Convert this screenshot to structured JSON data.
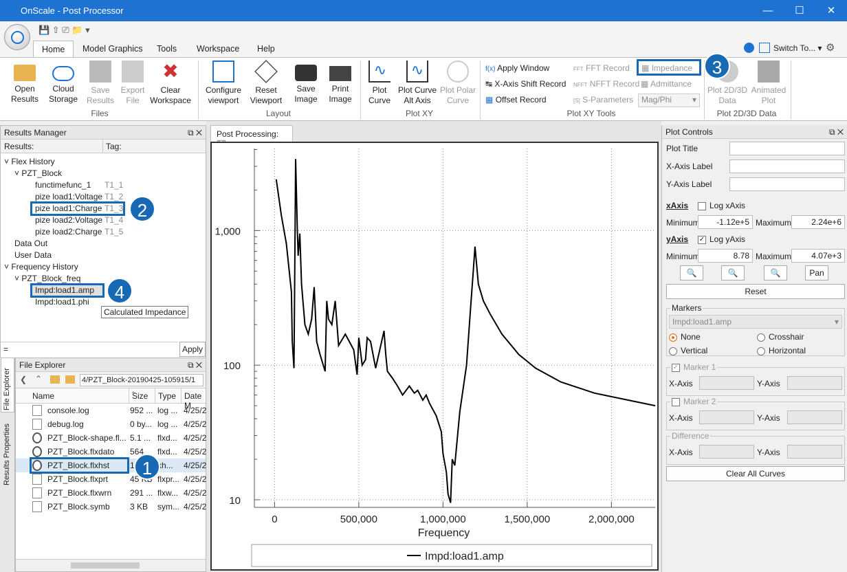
{
  "window": {
    "title": "OnScale - Post Processor",
    "min_icon": "minimize-icon",
    "max_icon": "maximize-icon",
    "close_icon": "close-icon"
  },
  "tabs": [
    {
      "label": "Home"
    },
    {
      "label": "Model Graphics"
    },
    {
      "label": "Tools"
    },
    {
      "label": "Workspace"
    },
    {
      "label": "Help"
    }
  ],
  "switch_to": "Switch To...",
  "ribbon": {
    "open": "Open\nResults",
    "cloud": "Cloud\nStorage",
    "save_results": "Save\nResults",
    "export": "Export\nFile",
    "clear": "Clear\nWorkspace",
    "files_group": "Files",
    "configure": "Configure\nviewport",
    "reset": "Reset\nViewport",
    "save_image": "Save\nImage",
    "print_image": "Print\nImage",
    "layout_group": "Layout",
    "plot_curve": "Plot\nCurve",
    "plot_alt": "Plot Curve\nAlt Axis",
    "plot_polar": "Plot Polar\nCurve",
    "plotxy_group": "Plot XY",
    "apply_window": "Apply Window",
    "xshift": "X-Axis Shift Record",
    "offset": "Offset Record",
    "fft": "FFT Record",
    "nfft": "NFFT Record",
    "sparam": "S-Parameters",
    "impedance": "Impedance",
    "admittance": "Admittance",
    "magphi": "Mag/Phi",
    "xytools_group": "Plot XY Tools",
    "plot2d3d": "Plot 2D/3D\nData",
    "animated": "Animated\nPlot",
    "plot2d_group": "Plot 2D/3D Data"
  },
  "results_manager": {
    "title": "Results Manager",
    "col_results": "Results:",
    "col_tag": "Tag:",
    "tree": [
      {
        "label": "Flex History",
        "tag": ""
      },
      {
        "label": "PZT_Block",
        "tag": ""
      },
      {
        "label": "functimefunc_1",
        "tag": "T1_1"
      },
      {
        "label": "pize load1:Voltage",
        "tag": "T1_2"
      },
      {
        "label": "pize load1:Charge",
        "tag": "T1_3"
      },
      {
        "label": "pize load2:Voltage",
        "tag": "T1_4"
      },
      {
        "label": "pize load2:Charge",
        "tag": "T1_5"
      },
      {
        "label": "Data Out",
        "tag": ""
      },
      {
        "label": "User Data",
        "tag": ""
      },
      {
        "label": "Frequency History",
        "tag": ""
      },
      {
        "label": "PZT_Block_freq",
        "tag": ""
      },
      {
        "label": "Impd:load1.amp",
        "tag": ""
      },
      {
        "label": "Impd:load1.phi",
        "tag": ""
      }
    ],
    "tooltip": "Calculated Impedance",
    "expr": "=",
    "apply": "Apply"
  },
  "file_explorer": {
    "title": "File Explorer",
    "path": "4/PZT_Block-20190425-105915/1",
    "cols": [
      "Name",
      "Size",
      "Type",
      "Date M"
    ],
    "files": [
      {
        "name": "console.log",
        "size": "952 ...",
        "type": "log ...",
        "date": "4/25/2"
      },
      {
        "name": "debug.log",
        "size": "0 by...",
        "type": "log ...",
        "date": "4/25/2"
      },
      {
        "name": "PZT_Block-shape.fl...",
        "size": "5.1 ...",
        "type": "flxd...",
        "date": "4/25/2"
      },
      {
        "name": "PZT_Block.flxdato",
        "size": "564",
        "type": "flxd...",
        "date": "4/25/2"
      },
      {
        "name": "PZT_Block.flxhst",
        "size": "1",
        "type": "xh...",
        "date": "4/25/2"
      },
      {
        "name": "PZT_Block.flxprt",
        "size": "45 KB",
        "type": "flxpr...",
        "date": "4/25/2"
      },
      {
        "name": "PZT_Block.flxwrn",
        "size": "291 ...",
        "type": "flxw...",
        "date": "4/25/2"
      },
      {
        "name": "PZT_Block.symb",
        "size": "3 KB",
        "type": "sym...",
        "date": "4/25/2"
      }
    ],
    "side_tabs": [
      "File Explorer",
      "Results Properties"
    ]
  },
  "post_tab": "Post Processing:",
  "chart_data": {
    "type": "line",
    "xlabel": "Frequency",
    "ylabel": "",
    "log_y": true,
    "xlim": [
      -120000,
      2260000
    ],
    "ylim": [
      8.78,
      4070
    ],
    "xticks": [
      0,
      500000,
      1000000,
      1500000,
      2000000
    ],
    "xtick_labels": [
      "0",
      "500,000",
      "1,000,000",
      "1,500,000",
      "2,000,000"
    ],
    "yticks": [
      10,
      100,
      1000
    ],
    "ytick_labels": [
      "10",
      "100",
      "1,000"
    ],
    "grid": true,
    "legend_position": "bottom",
    "series": [
      {
        "name": "Impd:load1.amp",
        "x": [
          10000,
          40000,
          70000,
          100000,
          105000,
          115000,
          122000,
          125000,
          135000,
          140000,
          150000,
          160000,
          180000,
          200000,
          220000,
          235000,
          250000,
          270000,
          300000,
          310000,
          320000,
          340000,
          360000,
          380000,
          420000,
          470000,
          490000,
          500000,
          520000,
          540000,
          550000,
          570000,
          600000,
          650000,
          660000,
          670000,
          700000,
          730000,
          760000,
          800000,
          830000,
          850000,
          880000,
          900000,
          920000,
          960000,
          990000,
          1000000,
          1020000,
          1030000,
          1045000,
          1055000,
          1070000,
          1100000,
          1140000,
          1165000,
          1180000,
          1190000,
          1210000,
          1240000,
          1280000,
          1350000,
          1450000,
          1550000,
          1700000,
          1900000,
          2100000,
          2260000
        ],
        "values": [
          2400,
          1300,
          800,
          350,
          150,
          95,
          1150,
          3400,
          1000,
          650,
          950,
          400,
          200,
          170,
          220,
          380,
          150,
          120,
          90,
          300,
          220,
          200,
          300,
          140,
          170,
          130,
          85,
          160,
          100,
          110,
          160,
          150,
          95,
          180,
          120,
          90,
          80,
          70,
          60,
          70,
          62,
          65,
          55,
          60,
          52,
          42,
          32,
          22,
          16,
          11,
          9.5,
          20,
          18,
          45,
          100,
          280,
          500,
          760,
          400,
          300,
          240,
          170,
          120,
          95,
          75,
          62,
          55,
          50
        ]
      }
    ]
  },
  "plot_controls": {
    "title": "Plot Controls",
    "plot_title": "Plot Title",
    "x_label": "X-Axis Label",
    "y_label": "Y-Axis Label",
    "xaxis": "xAxis",
    "log_x": "Log xAxis",
    "x_min_lbl": "Minimum",
    "x_min": "-1.12e+5",
    "x_max_lbl": "Maximum",
    "x_max": "2.24e+6",
    "yaxis": "yAxis",
    "log_y": "Log yAxis",
    "y_min_lbl": "Minimum",
    "y_min": "8.78",
    "y_max_lbl": "Maximum",
    "y_max": "4.07e+3",
    "pan": "Pan",
    "reset": "Reset",
    "markers": "Markers",
    "marker_select": "Impd:load1.amp",
    "none": "None",
    "crosshair": "Crosshair",
    "vertical": "Vertical",
    "horizontal": "Horizontal",
    "marker1": "Marker 1",
    "marker2": "Marker 2",
    "difference": "Difference",
    "xaxis_lbl": "X-Axis",
    "yaxis_lbl": "Y-Axis",
    "clear_all": "Clear All Curves"
  },
  "callouts": [
    "1",
    "2",
    "3",
    "4"
  ]
}
